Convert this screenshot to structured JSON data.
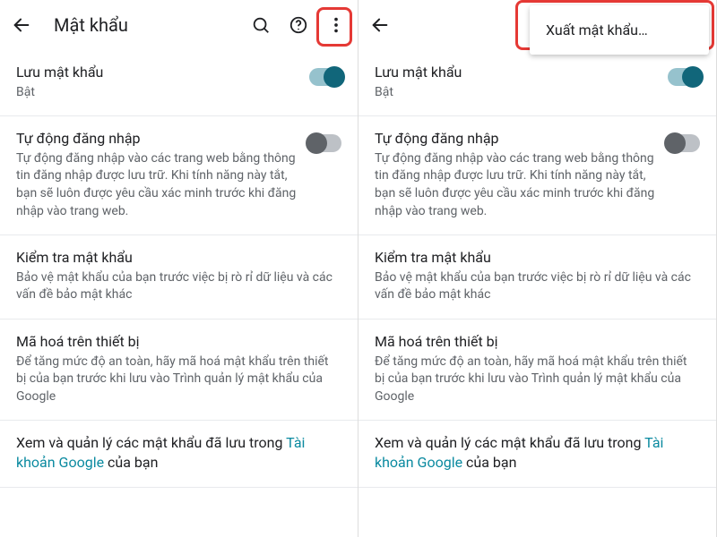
{
  "header": {
    "title": "Mật khẩu"
  },
  "rows": {
    "save_pw": {
      "title": "Lưu mật khẩu",
      "sub": "Bật",
      "toggle": "on"
    },
    "auto_signin": {
      "title": "Tự động đăng nhập",
      "sub": "Tự động đăng nhập vào các trang web bằng thông tin đăng nhập được lưu trữ. Khi tính năng này tắt, bạn sẽ luôn được yêu cầu xác minh trước khi đăng nhập vào trang web.",
      "toggle": "off"
    },
    "check_pw": {
      "title": "Kiểm tra mật khẩu",
      "sub": "Bảo vệ mật khẩu của bạn trước việc bị rò rỉ dữ liệu và các vấn đề bảo mật khác"
    },
    "encrypt": {
      "title": "Mã hoá trên thiết bị",
      "sub": "Để tăng mức độ an toàn, hãy mã hoá mật khẩu trên thiết bị của bạn trước khi lưu vào Trình quản lý mật khẩu của Google"
    },
    "manage": {
      "pre": "Xem và quản lý các mật khẩu đã lưu trong ",
      "link": "Tài khoản Google",
      "post": " của bạn"
    }
  },
  "menu": {
    "export": "Xuất mật khẩu…"
  }
}
